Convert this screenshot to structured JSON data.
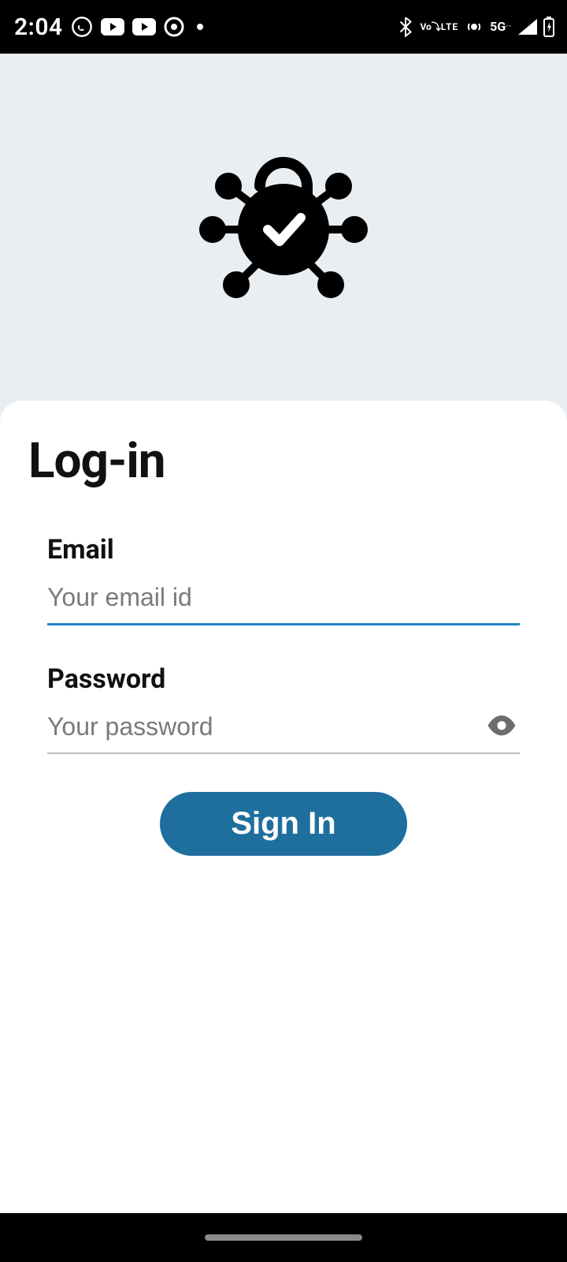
{
  "status_bar": {
    "time": "2:04",
    "network_type": "5G",
    "volte_label": "VoLTE"
  },
  "hero": {
    "logo_semantic": "secure-network-lock"
  },
  "login": {
    "title": "Log-in",
    "email": {
      "label": "Email",
      "placeholder": "Your email id",
      "value": ""
    },
    "password": {
      "label": "Password",
      "placeholder": "Your password",
      "value": ""
    },
    "signin_label": "Sign In"
  },
  "colors": {
    "accent": "#1f88c7",
    "button": "#1f6f9e",
    "page_bg": "#e9eef3"
  }
}
